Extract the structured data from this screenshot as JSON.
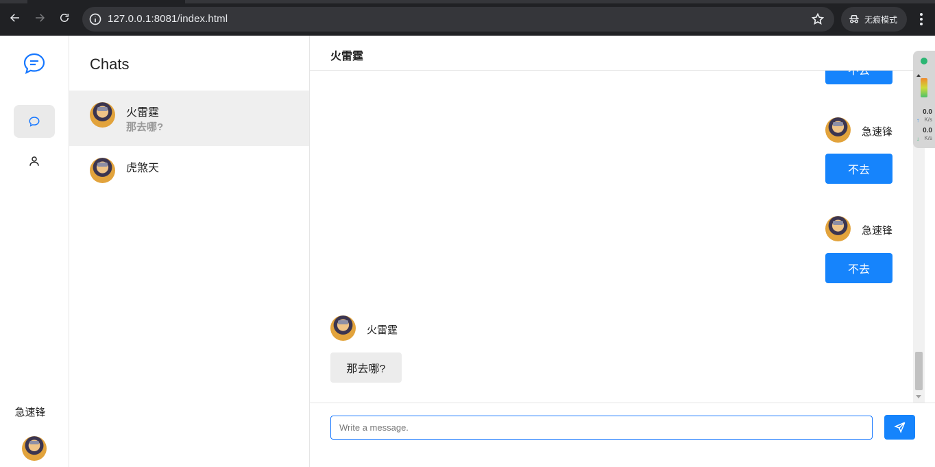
{
  "browser": {
    "url": "127.0.0.1:8081/index.html",
    "incognito_label": "无痕模式"
  },
  "rail": {
    "current_user": "急速锋"
  },
  "chat_list": {
    "heading": "Chats",
    "items": [
      {
        "name": "火雷霆",
        "preview": "那去哪?"
      },
      {
        "name": "虎煞天",
        "preview": ""
      }
    ]
  },
  "conversation": {
    "title": "火雷霆",
    "messages": [
      {
        "sender": "",
        "text": "不去",
        "mine": true
      },
      {
        "sender": "急速锋",
        "text": "不去",
        "mine": true
      },
      {
        "sender": "急速锋",
        "text": "不去",
        "mine": true
      },
      {
        "sender": "火雷霆",
        "text": "那去哪?",
        "mine": false
      }
    ],
    "input_placeholder": "Write a message."
  },
  "net_monitor": {
    "upload_value": "0.0",
    "upload_unit": "K/s",
    "download_value": "0.0",
    "download_unit": "K/s"
  },
  "colors": {
    "accent": "#1677ff",
    "my_bubble": "#1684fc",
    "their_bubble": "#ececec"
  }
}
